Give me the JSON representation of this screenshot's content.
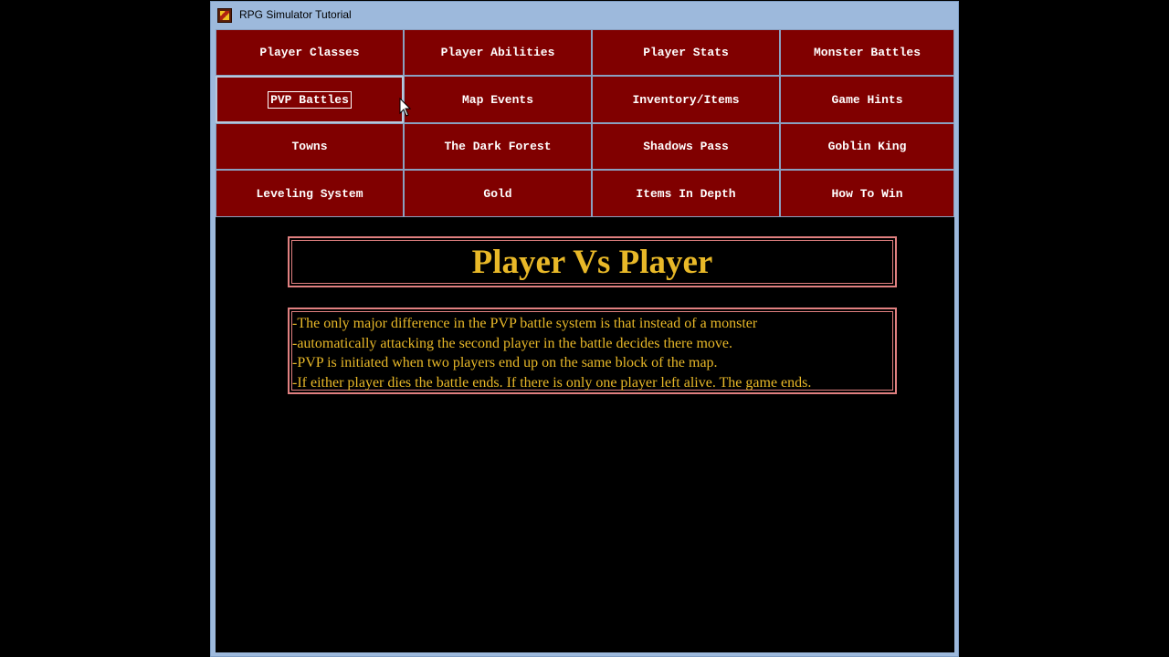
{
  "window": {
    "title": "RPG Simulator Tutorial"
  },
  "nav": {
    "items": [
      {
        "label": "Player Classes"
      },
      {
        "label": "Player Abilities"
      },
      {
        "label": "Player Stats"
      },
      {
        "label": "Monster Battles"
      },
      {
        "label": "PVP Battles"
      },
      {
        "label": "Map Events"
      },
      {
        "label": "Inventory/Items"
      },
      {
        "label": "Game Hints"
      },
      {
        "label": "Towns"
      },
      {
        "label": "The Dark Forest"
      },
      {
        "label": "Shadows Pass"
      },
      {
        "label": "Goblin King"
      },
      {
        "label": "Leveling System"
      },
      {
        "label": "Gold"
      },
      {
        "label": "Items In Depth"
      },
      {
        "label": "How To Win"
      }
    ],
    "active_index": 4
  },
  "page": {
    "heading": "Player Vs Player",
    "lines": [
      "-The only major difference in the PVP battle system is that instead of a monster",
      "-automatically attacking the second player in the battle decides there move.",
      "-PVP is initiated when two players end up on the same block of the map.",
      "-If either player dies the battle ends. If there is only one player left alive. The game ends."
    ]
  },
  "colors": {
    "button_bg": "#800000",
    "heading_text": "#e8b828",
    "box_border": "#e08080",
    "background": "#000000",
    "window_frame": "#9db9dc"
  },
  "icons": {
    "app": "app-icon",
    "pointer": "mouse-pointer-icon"
  }
}
